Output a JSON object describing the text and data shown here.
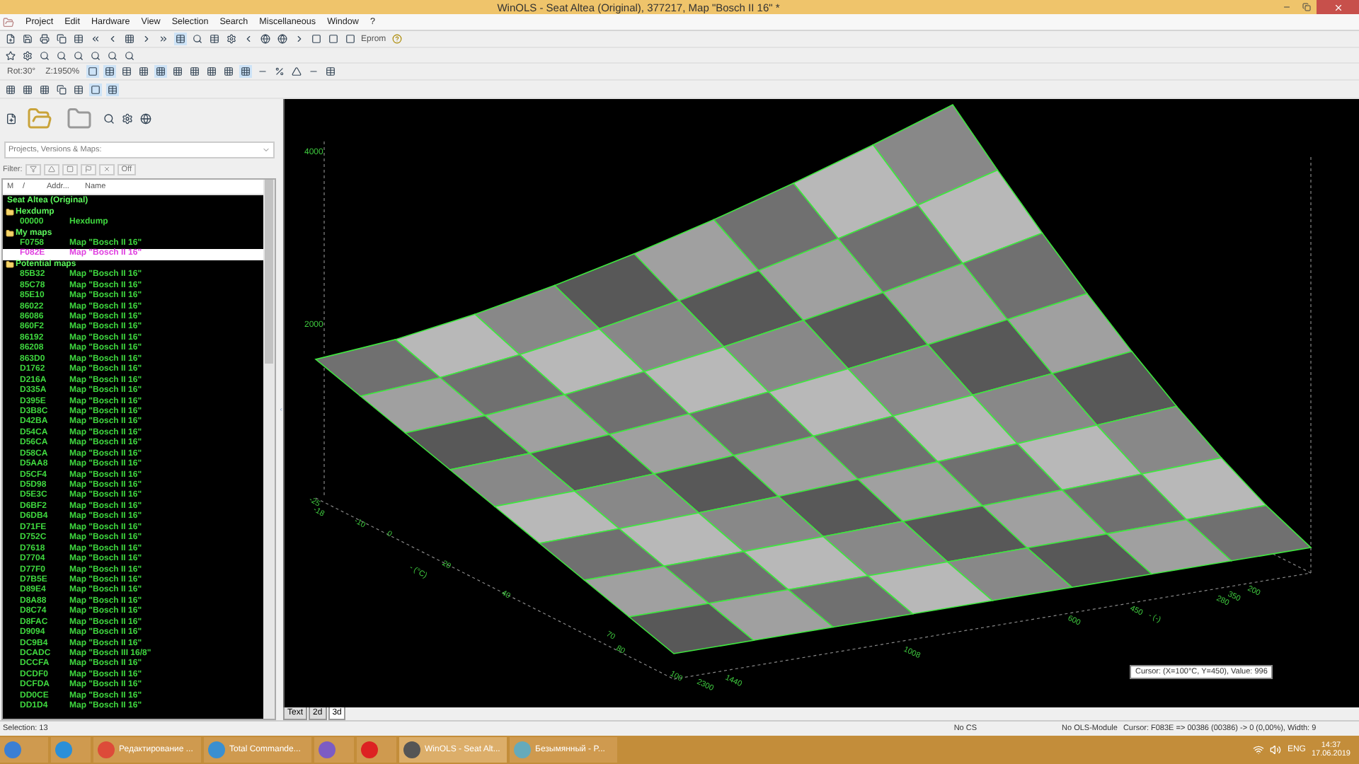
{
  "window": {
    "title": "WinOLS - Seat Altea (Original), 377217, Map \"Bosch II 16\" *"
  },
  "menu": [
    "Project",
    "Edit",
    "Hardware",
    "View",
    "Selection",
    "Search",
    "Miscellaneous",
    "Window",
    "?"
  ],
  "toolbar": {
    "eprom_label": "Eprom",
    "rotation": "Rot:30°",
    "zoom": "Z:1950%"
  },
  "project_panel": {
    "selector": "Projects, Versions & Maps:",
    "filter_label": "Filter:",
    "filter_off": "Off",
    "columns": [
      "M",
      "/",
      "Addr...",
      "Name"
    ],
    "tree": [
      {
        "label": "Seat Altea (Original)",
        "children": [
          {
            "label": "Hexdump",
            "children": [
              {
                "address": "00000",
                "name": "Hexdump",
                "selected": false
              }
            ]
          },
          {
            "label": "My maps",
            "children": [
              {
                "address": "F0758",
                "name": "Map \"Bosch II 16\"",
                "selected": false
              },
              {
                "address": "F082E",
                "name": "Map \"Bosch II 16\"",
                "selected": true
              }
            ]
          },
          {
            "label": "Potential maps",
            "children": [
              {
                "address": "85B32",
                "name": "Map \"Bosch II 16\"",
                "selected": false
              },
              {
                "address": "85C78",
                "name": "Map \"Bosch II 16\"",
                "selected": false
              },
              {
                "address": "85E10",
                "name": "Map \"Bosch II 16\"",
                "selected": false
              },
              {
                "address": "86022",
                "name": "Map \"Bosch II 16\"",
                "selected": false
              },
              {
                "address": "86086",
                "name": "Map \"Bosch II 16\"",
                "selected": false
              },
              {
                "address": "860F2",
                "name": "Map \"Bosch II 16\"",
                "selected": false
              },
              {
                "address": "86192",
                "name": "Map \"Bosch II 16\"",
                "selected": false
              },
              {
                "address": "86208",
                "name": "Map \"Bosch II 16\"",
                "selected": false
              },
              {
                "address": "863D0",
                "name": "Map \"Bosch II 16\"",
                "selected": false
              },
              {
                "address": "D1762",
                "name": "Map \"Bosch II 16\"",
                "selected": false
              },
              {
                "address": "D216A",
                "name": "Map \"Bosch II 16\"",
                "selected": false
              },
              {
                "address": "D335A",
                "name": "Map \"Bosch II 16\"",
                "selected": false
              },
              {
                "address": "D395E",
                "name": "Map \"Bosch II 16\"",
                "selected": false
              },
              {
                "address": "D3B8C",
                "name": "Map \"Bosch II 16\"",
                "selected": false
              },
              {
                "address": "D42BA",
                "name": "Map \"Bosch II 16\"",
                "selected": false
              },
              {
                "address": "D54CA",
                "name": "Map \"Bosch II 16\"",
                "selected": false
              },
              {
                "address": "D56CA",
                "name": "Map \"Bosch II 16\"",
                "selected": false
              },
              {
                "address": "D58CA",
                "name": "Map \"Bosch II 16\"",
                "selected": false
              },
              {
                "address": "D5AA8",
                "name": "Map \"Bosch II 16\"",
                "selected": false
              },
              {
                "address": "D5CF4",
                "name": "Map \"Bosch II 16\"",
                "selected": false
              },
              {
                "address": "D5D98",
                "name": "Map \"Bosch II 16\"",
                "selected": false
              },
              {
                "address": "D5E3C",
                "name": "Map \"Bosch II 16\"",
                "selected": false
              },
              {
                "address": "D6BF2",
                "name": "Map \"Bosch II 16\"",
                "selected": false
              },
              {
                "address": "D6DB4",
                "name": "Map \"Bosch II 16\"",
                "selected": false
              },
              {
                "address": "D71FE",
                "name": "Map \"Bosch II 16\"",
                "selected": false
              },
              {
                "address": "D752C",
                "name": "Map \"Bosch II 16\"",
                "selected": false
              },
              {
                "address": "D7618",
                "name": "Map \"Bosch II 16\"",
                "selected": false
              },
              {
                "address": "D7704",
                "name": "Map \"Bosch II 16\"",
                "selected": false
              },
              {
                "address": "D77F0",
                "name": "Map \"Bosch II 16\"",
                "selected": false
              },
              {
                "address": "D7B5E",
                "name": "Map \"Bosch II 16\"",
                "selected": false
              },
              {
                "address": "D89E4",
                "name": "Map \"Bosch II 16\"",
                "selected": false
              },
              {
                "address": "D8A88",
                "name": "Map \"Bosch II 16\"",
                "selected": false
              },
              {
                "address": "D8C74",
                "name": "Map \"Bosch II 16\"",
                "selected": false
              },
              {
                "address": "D8FAC",
                "name": "Map \"Bosch II 16\"",
                "selected": false
              },
              {
                "address": "D9094",
                "name": "Map \"Bosch II 16\"",
                "selected": false
              },
              {
                "address": "DC9B4",
                "name": "Map \"Bosch II 16\"",
                "selected": false
              },
              {
                "address": "DCADC",
                "name": "Map \"Bosch III 16/8\"",
                "selected": false
              },
              {
                "address": "DCCFA",
                "name": "Map \"Bosch II 16\"",
                "selected": false
              },
              {
                "address": "DCDF0",
                "name": "Map \"Bosch II 16\"",
                "selected": false
              },
              {
                "address": "DCFDA",
                "name": "Map \"Bosch II 16\"",
                "selected": false
              },
              {
                "address": "DD0CE",
                "name": "Map \"Bosch II 16\"",
                "selected": false
              },
              {
                "address": "DD1D4",
                "name": "Map \"Bosch II 16\"",
                "selected": false
              }
            ]
          }
        ]
      }
    ],
    "selection": "Selection: 13"
  },
  "plot": {
    "z_ticks": [
      "4000",
      "2000"
    ],
    "x_ticks": [
      "-25",
      "-18",
      "-10",
      "0",
      "20",
      "40",
      "70",
      "80",
      "100"
    ],
    "x_label": "- (°C)",
    "y_ticks": [
      "2300",
      "1440",
      "1008",
      "600",
      "450",
      "280",
      "350",
      "200"
    ],
    "y_label": "- (-)",
    "cursor_tooltip": "Cursor: (X=100°C, Y=450), Value: 996"
  },
  "view_tabs": [
    {
      "label": "Text",
      "selected": false
    },
    {
      "label": "2d",
      "selected": false
    },
    {
      "label": "3d",
      "selected": true
    }
  ],
  "status_bar": {
    "checksum": "No CS",
    "module": "No OLS-Module",
    "cursor": "Cursor: F083E => 00386 (00386) -> 0 (0,00%), Width: 9"
  },
  "taskbar": {
    "apps": [
      {
        "kind": "pinned",
        "active": false
      },
      {
        "kind": "window",
        "label": "Редактирование ...",
        "active": false
      },
      {
        "kind": "window",
        "label": "Total Commande...",
        "active": false
      },
      {
        "kind": "pinned",
        "active": false
      },
      {
        "kind": "pinned",
        "active": false
      },
      {
        "kind": "window",
        "label": "WinOLS - Seat Alt...",
        "active": true
      },
      {
        "kind": "window",
        "label": "Безымянный - P...",
        "active": false
      }
    ],
    "language": "ENG",
    "time": "14:37",
    "date": "17.06.2019"
  }
}
